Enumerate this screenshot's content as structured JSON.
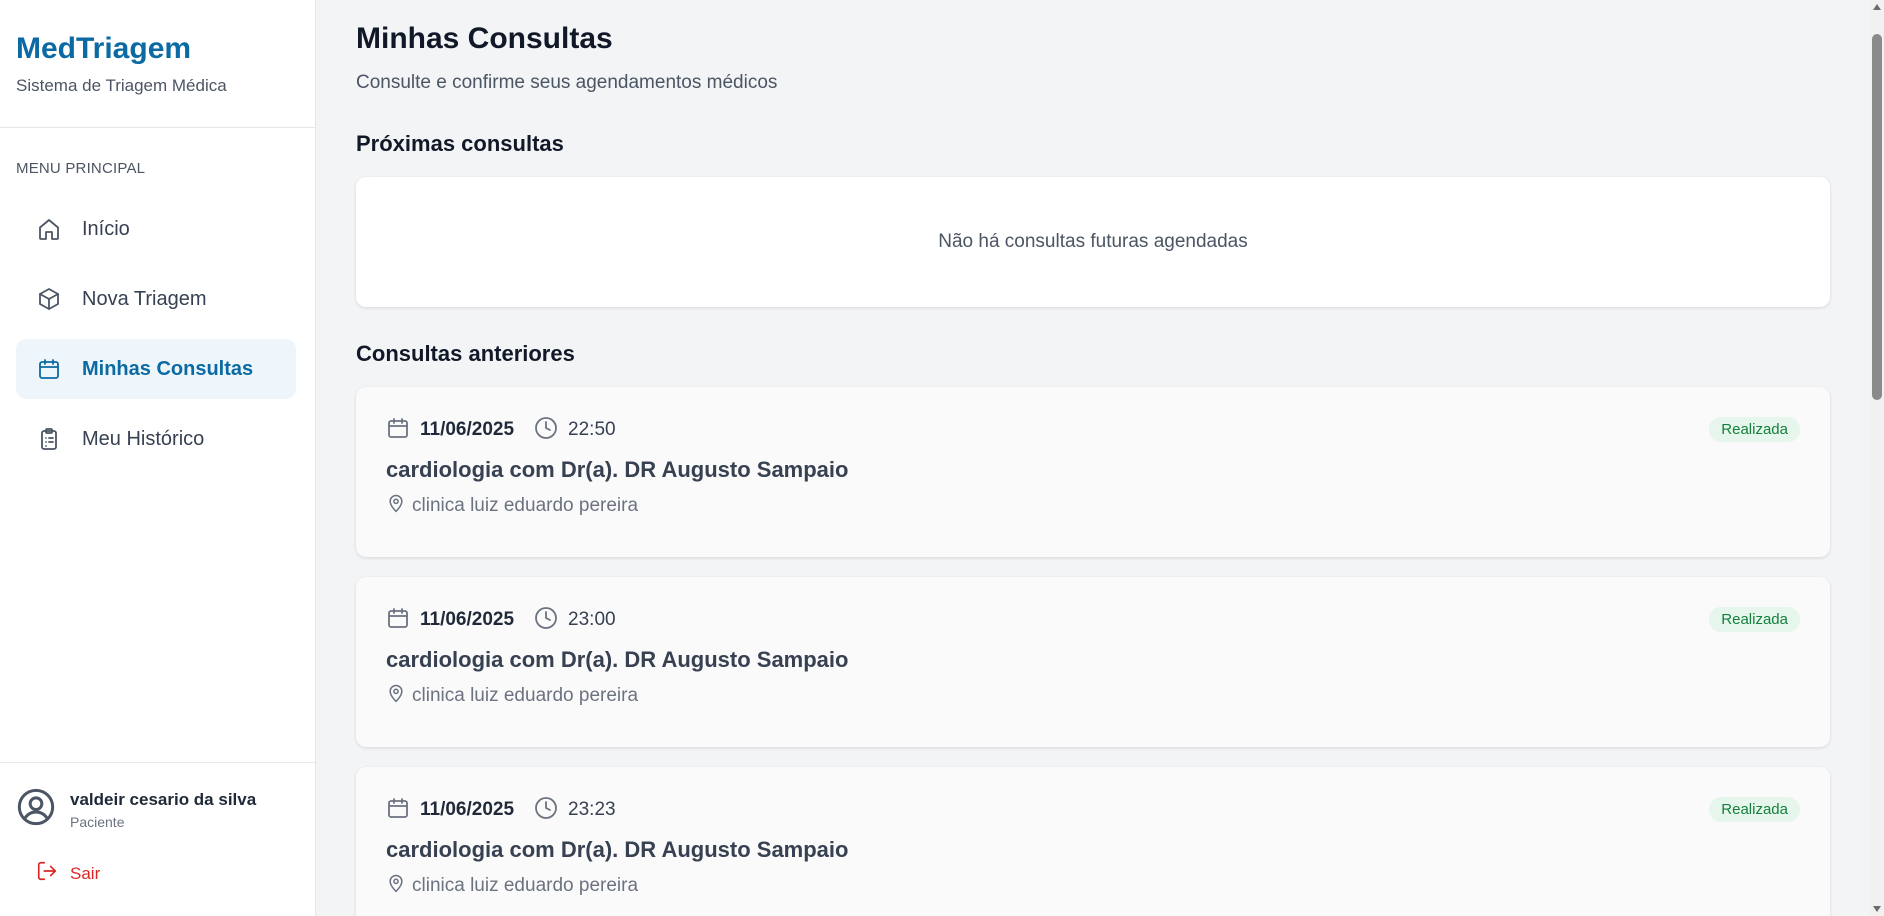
{
  "brand": {
    "title": "MedTriagem",
    "subtitle": "Sistema de Triagem Médica"
  },
  "menu": {
    "label": "MENU PRINCIPAL",
    "items": [
      {
        "label": "Início",
        "icon": "home-icon",
        "active": false
      },
      {
        "label": "Nova Triagem",
        "icon": "cube-icon",
        "active": false
      },
      {
        "label": "Minhas Consultas",
        "icon": "calendar-icon",
        "active": true
      },
      {
        "label": "Meu Histórico",
        "icon": "clipboard-icon",
        "active": false
      }
    ]
  },
  "user": {
    "name": "valdeir cesario da silva",
    "role": "Paciente",
    "logout_label": "Sair"
  },
  "page": {
    "title": "Minhas Consultas",
    "subtitle": "Consulte e confirme seus agendamentos médicos"
  },
  "upcoming": {
    "title": "Próximas consultas",
    "empty_text": "Não há consultas futuras agendadas"
  },
  "past": {
    "title": "Consultas anteriores",
    "appointments": [
      {
        "date": "11/06/2025",
        "time": "22:50",
        "title": "cardiologia com Dr(a). DR Augusto Sampaio",
        "location": "clinica luiz eduardo pereira",
        "status": "Realizada"
      },
      {
        "date": "11/06/2025",
        "time": "23:00",
        "title": "cardiologia com Dr(a). DR Augusto Sampaio",
        "location": "clinica luiz eduardo pereira",
        "status": "Realizada"
      },
      {
        "date": "11/06/2025",
        "time": "23:23",
        "title": "cardiologia com Dr(a). DR Augusto Sampaio",
        "location": "clinica luiz eduardo pereira",
        "status": "Realizada"
      }
    ]
  },
  "colors": {
    "brand": "#0b6aa3",
    "active_bg": "#eef6fb",
    "status_bg": "#e6f6ec",
    "status_text": "#15803d",
    "logout": "#dc2626"
  }
}
